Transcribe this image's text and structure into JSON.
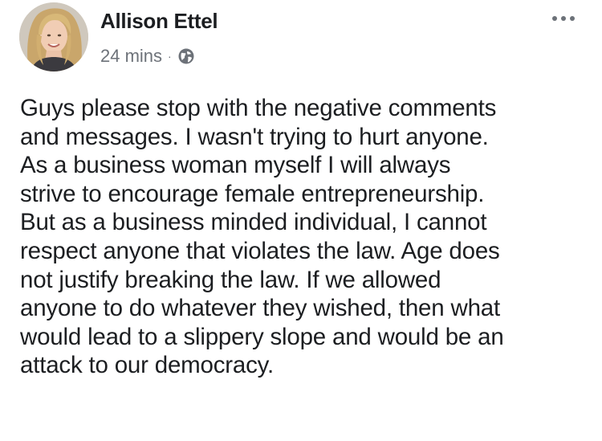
{
  "post": {
    "author": {
      "name": "Allison Ettel",
      "avatar": "profile-photo"
    },
    "meta": {
      "time": "24 mins",
      "separator": "·",
      "privacy_icon": "globe-icon"
    },
    "more_icon": "more-horizontal-icon",
    "text_lines": [
      "Guys please stop with the negative comments",
      "and messages. I wasn't trying to hurt anyone.",
      "As a business woman myself I will always",
      "strive to encourage female entrepreneurship.",
      "But as a business minded individual, I cannot",
      "respect anyone that violates the law. Age does",
      "not justify breaking the law. If we allowed",
      "anyone to do whatever they wished, then what",
      "would lead to a slippery slope and would be an",
      "attack to our democracy."
    ]
  },
  "colors": {
    "text": "#1c1e21",
    "secondary_text": "#6d7279",
    "background": "#ffffff"
  }
}
